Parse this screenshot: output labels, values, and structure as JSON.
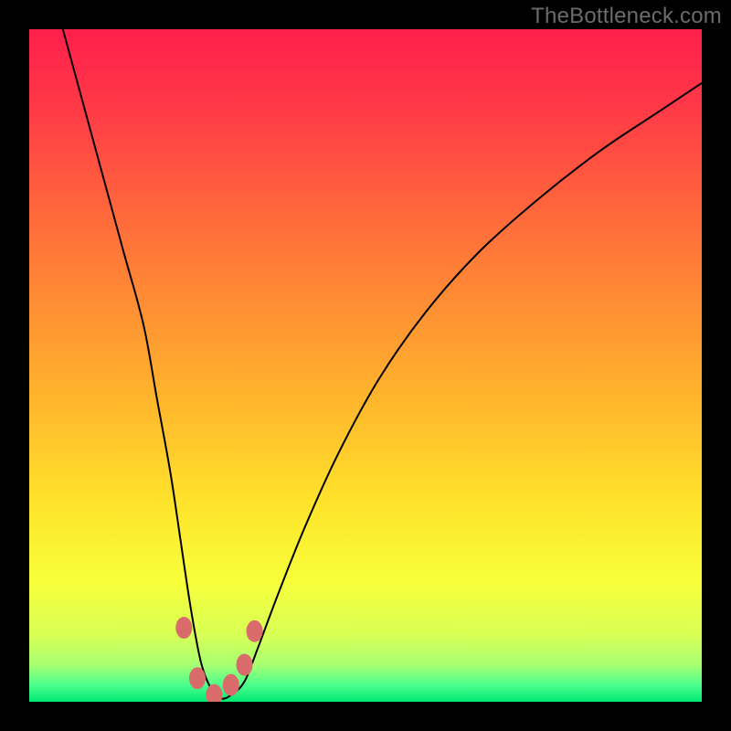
{
  "watermark": {
    "text": "TheBottleneck.com"
  },
  "colors": {
    "gradient_stops": [
      {
        "offset": 0.0,
        "color": "#ff1f4b"
      },
      {
        "offset": 0.12,
        "color": "#ff3a47"
      },
      {
        "offset": 0.28,
        "color": "#ff6a3b"
      },
      {
        "offset": 0.42,
        "color": "#ff9133"
      },
      {
        "offset": 0.56,
        "color": "#ffb82c"
      },
      {
        "offset": 0.7,
        "color": "#ffe22b"
      },
      {
        "offset": 0.82,
        "color": "#f8ff3a"
      },
      {
        "offset": 0.9,
        "color": "#d8ff55"
      },
      {
        "offset": 0.945,
        "color": "#a8ff72"
      },
      {
        "offset": 0.975,
        "color": "#4dff8c"
      },
      {
        "offset": 1.0,
        "color": "#00e873"
      }
    ],
    "curve": "#000000",
    "marker": "#d96b6b",
    "background": "#000000"
  },
  "chart_data": {
    "type": "line",
    "title": "",
    "xlabel": "",
    "ylabel": "",
    "xlim": [
      0,
      100
    ],
    "ylim": [
      0,
      100
    ],
    "grid": false,
    "legend": false,
    "series": [
      {
        "name": "bottleneck-curve",
        "x": [
          5,
          8,
          11,
          14,
          17,
          19,
          21,
          22.5,
          24,
          25.5,
          27,
          28.5,
          30,
          32,
          34,
          37,
          41,
          46,
          52,
          59,
          67,
          76,
          85,
          94,
          100
        ],
        "y": [
          100,
          89,
          78,
          67,
          56,
          45,
          34,
          24,
          14,
          6,
          2,
          0.5,
          1,
          3,
          8,
          16,
          26,
          37,
          48,
          58,
          67,
          75,
          82,
          88,
          92
        ]
      }
    ],
    "markers": [
      {
        "x": 23.0,
        "y": 11.0
      },
      {
        "x": 25.0,
        "y": 3.5
      },
      {
        "x": 27.5,
        "y": 1.0
      },
      {
        "x": 30.0,
        "y": 2.5
      },
      {
        "x": 32.0,
        "y": 5.5
      },
      {
        "x": 33.5,
        "y": 10.5
      }
    ]
  }
}
